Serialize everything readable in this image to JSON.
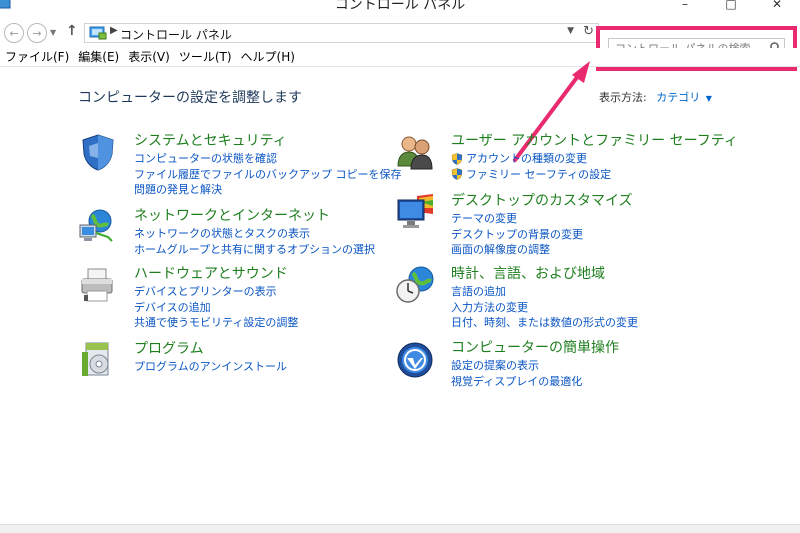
{
  "window": {
    "title": "コントロール パネル"
  },
  "address": {
    "path": "コントロール パネル"
  },
  "search": {
    "placeholder": "コントロール パネルの検索"
  },
  "menu": [
    "ファイル(F)",
    "編集(E)",
    "表示(V)",
    "ツール(T)",
    "ヘルプ(H)"
  ],
  "page": {
    "title": "コンピューターの設定を調整します",
    "view_label": "表示方法:",
    "view_value": "カテゴリ"
  },
  "categories": [
    {
      "title": "システムとセキュリティ",
      "icon": "shield-icon",
      "links": [
        "コンピューターの状態を確認",
        "ファイル履歴でファイルのバックアップ コピーを保存",
        "問題の発見と解決"
      ]
    },
    {
      "title": "ネットワークとインターネット",
      "icon": "network-icon",
      "links": [
        "ネットワークの状態とタスクの表示",
        "ホームグループと共有に関するオプションの選択"
      ]
    },
    {
      "title": "ハードウェアとサウンド",
      "icon": "printer-icon",
      "links": [
        "デバイスとプリンターの表示",
        "デバイスの追加",
        "共通で使うモビリティ設定の調整"
      ]
    },
    {
      "title": "プログラム",
      "icon": "programs-icon",
      "links": [
        "プログラムのアンインストール"
      ]
    },
    {
      "title": "ユーザー アカウントとファミリー セーフティ",
      "icon": "users-icon",
      "links": [
        "アカウントの種類の変更",
        "ファミリー セーフティの設定"
      ]
    },
    {
      "title": "デスクトップのカスタマイズ",
      "icon": "monitor-icon",
      "links": [
        "テーマの変更",
        "デスクトップの背景の変更",
        "画面の解像度の調整"
      ]
    },
    {
      "title": "時計、言語、および地域",
      "icon": "clock-globe-icon",
      "links": [
        "言語の追加",
        "入力方法の変更",
        "日付、時刻、または数値の形式の変更"
      ]
    },
    {
      "title": "コンピューターの簡単操作",
      "icon": "ease-of-access-icon",
      "links": [
        "設定の提案の表示",
        "視覚ディスプレイの最適化"
      ]
    }
  ],
  "colors": {
    "accent_link": "#0a55c4",
    "category_title": "#1f7f1f",
    "highlight_box": "#ea2a6e"
  }
}
